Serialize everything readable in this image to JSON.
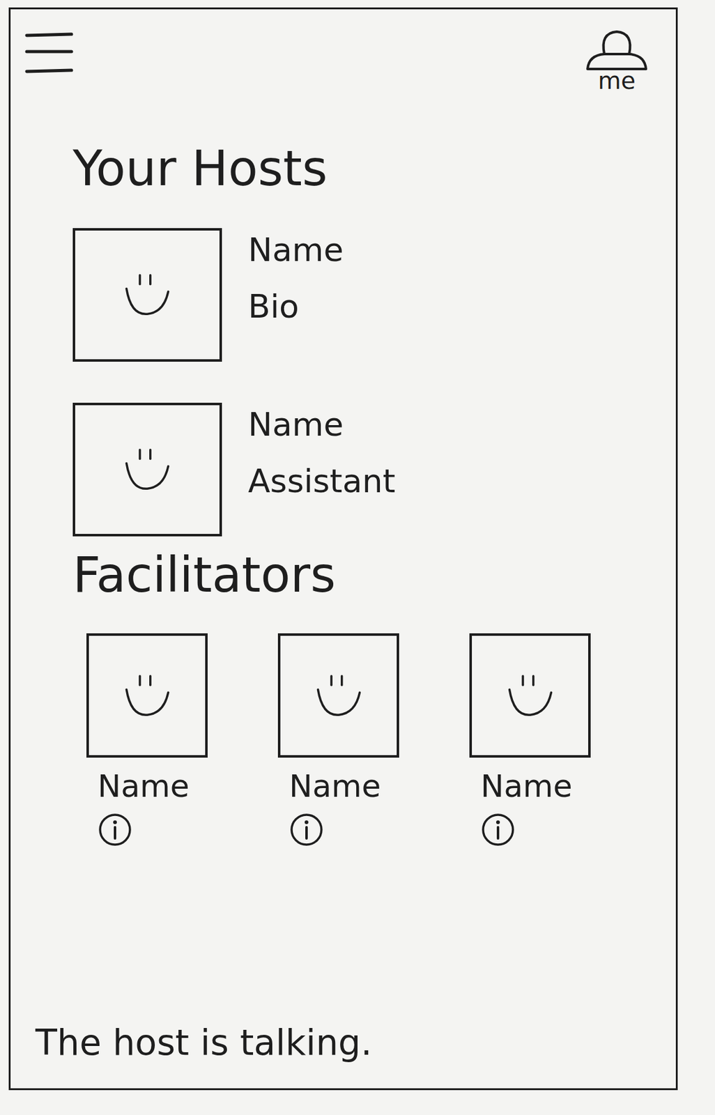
{
  "header": {
    "profile_label": "me"
  },
  "hosts": {
    "title": "Your Hosts",
    "items": [
      {
        "name": "Name",
        "detail": "Bio"
      },
      {
        "name": "Name",
        "detail": "Assistant"
      }
    ]
  },
  "facilitators": {
    "title": "Facilitators",
    "items": [
      {
        "name": "Name"
      },
      {
        "name": "Name"
      },
      {
        "name": "Name"
      }
    ]
  },
  "status_bar": "The host is talking."
}
